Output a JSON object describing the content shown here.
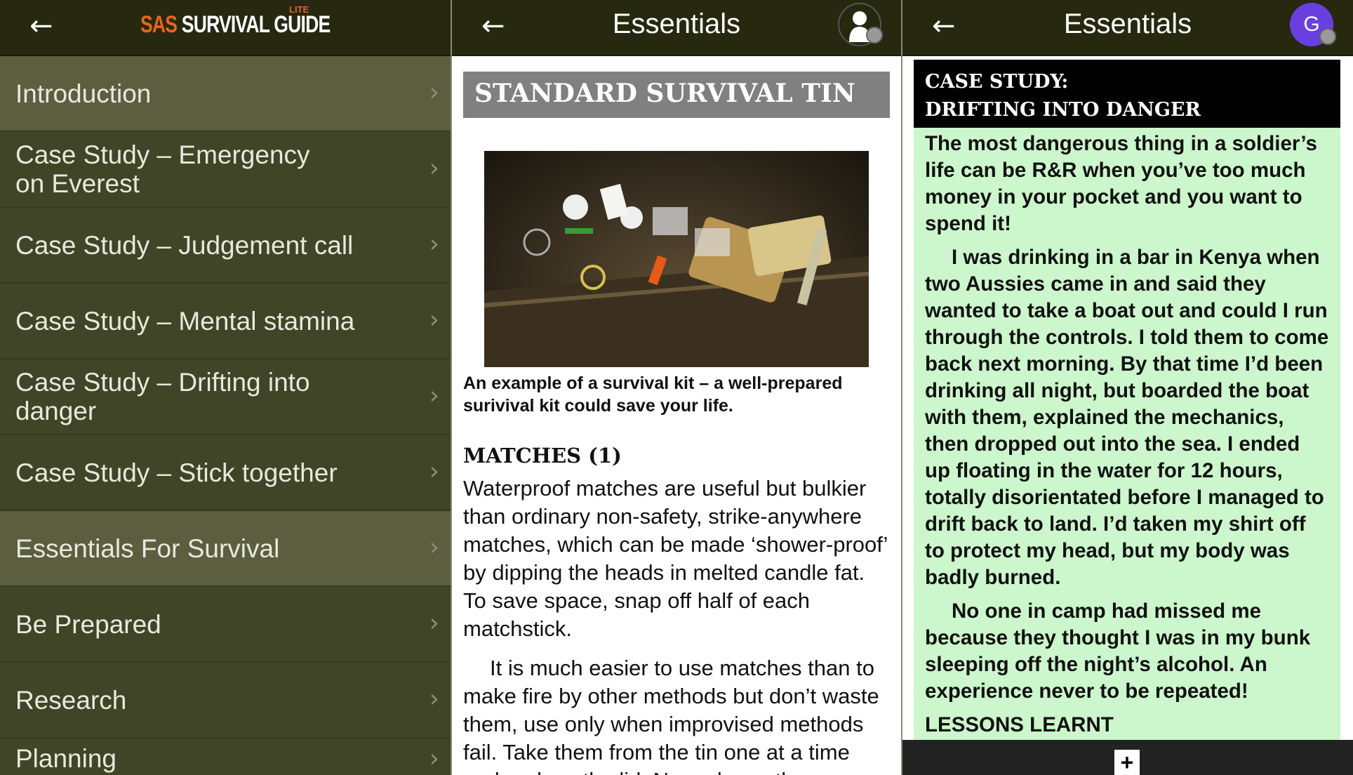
{
  "left_panel": {
    "logo": {
      "sas": "SAS",
      "rest": "SURVIVAL GUIDE",
      "lite": "LITE"
    },
    "items": [
      {
        "label": "Introduction"
      },
      {
        "label": "Case Study – Emergency on Everest"
      },
      {
        "label": "Case Study – Judgement call"
      },
      {
        "label": "Case Study – Mental stamina"
      },
      {
        "label": "Case Study – Drifting into danger"
      },
      {
        "label": "Case Study – Stick together"
      },
      {
        "label": "Essentials For Survival"
      },
      {
        "label": "Be Prepared"
      },
      {
        "label": "Research"
      },
      {
        "label": "Planning"
      }
    ]
  },
  "middle_panel": {
    "title": "Essentials",
    "section_title": "STANDARD SURVIVAL TIN",
    "caption": "An example of a survival kit – a well-prepared surivival kit could save your life.",
    "subheading": "MATCHES (1)",
    "paragraphs": [
      "Waterproof matches are useful but bulkier than ordinary non-safety, strike-anywhere matches, which can be made ‘shower-proof’ by dipping the heads in melted candle fat. To save space, snap off half of each matchstick.",
      "It is much easier to use matches than to make fire by other methods but don’t waste them, use only when improvised methods fail. Take them from the tin one at a time and replace the lid. Never leave the"
    ]
  },
  "right_panel": {
    "title": "Essentials",
    "avatar_letter": "G",
    "avatar_color": "#6a3fe0",
    "case_title_1": "CASE STUDY:",
    "case_title_2": "DRIFTING INTO DANGER",
    "paragraphs": [
      "The most dangerous thing in a soldier’s life can be R&R when you’ve too much money in your pocket and you want to spend it!",
      "I was drinking in a bar in Kenya when two Aussies came in and said they wanted to take a boat out and could I run through the controls. I told them to come back next morning. By that time I’d been drinking all night, but boarded the boat with them, explained the mechanics, then dropped out into the sea. I ended up floating in the water for 12 hours, totally disorientated before I managed to drift back to land. I’d taken my shirt off to protect my head, but my body was badly burned.",
      "No one in camp had missed me because they thought I was in my bunk sleeping off the night’s alcohol. An experience never to be repeated!"
    ],
    "lessons": "LESSONS LEARNT",
    "plus": "+"
  },
  "colors": {
    "header": "#262810",
    "sidebar": "#404527",
    "accent": "#e8651a",
    "case_bg": "#ccf7cc"
  }
}
